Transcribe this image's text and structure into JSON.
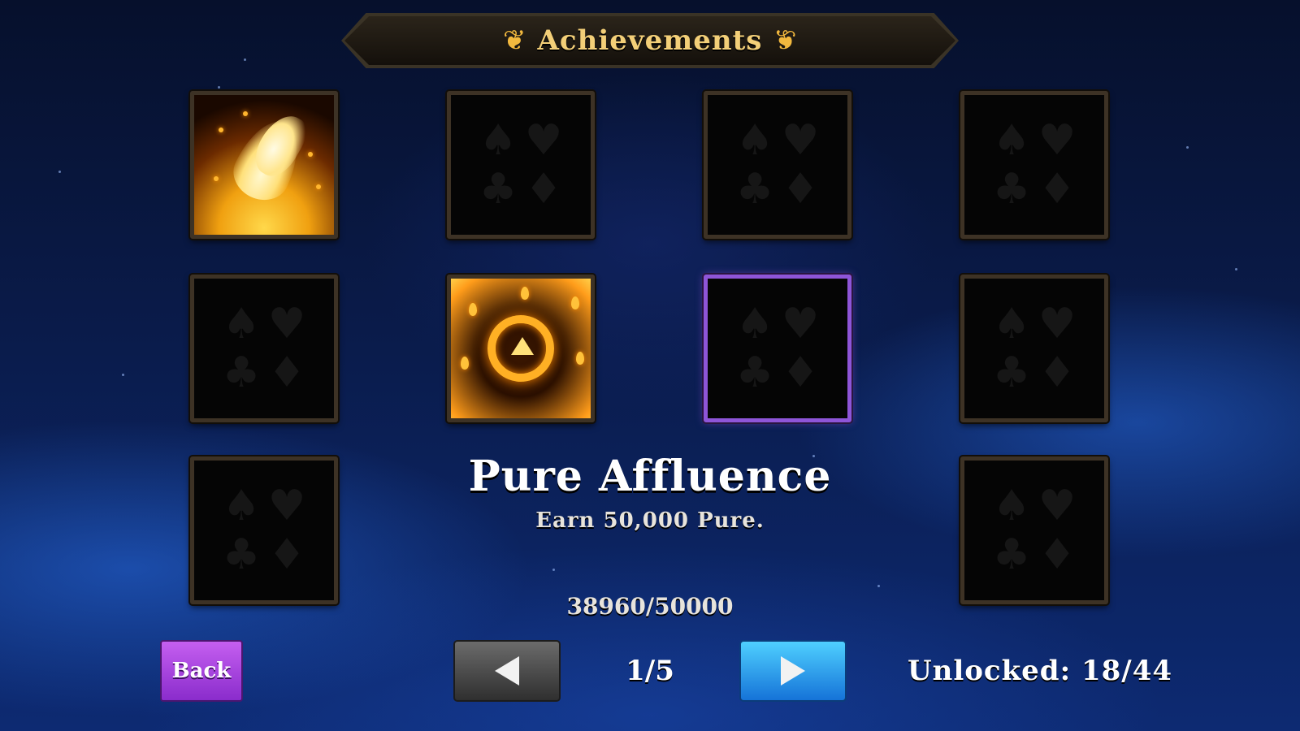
{
  "header": {
    "title": "Achievements",
    "left_flourish_icon": "ornament-flourish-icon",
    "right_flourish_icon": "ornament-flourish-icon"
  },
  "grid": {
    "tiles": [
      {
        "state": "unlocked",
        "icon": "phoenix-flame-icon"
      },
      {
        "state": "locked",
        "icon": "card-suits-icon"
      },
      {
        "state": "locked",
        "icon": "card-suits-icon"
      },
      {
        "state": "locked",
        "icon": "card-suits-icon"
      },
      {
        "state": "locked",
        "icon": "card-suits-icon"
      },
      {
        "state": "unlocked",
        "icon": "fire-ring-icon"
      },
      {
        "state": "locked",
        "icon": "card-suits-icon",
        "selected": true
      },
      {
        "state": "locked",
        "icon": "card-suits-icon"
      },
      {
        "state": "locked",
        "icon": "card-suits-icon"
      },
      {
        "state": "locked",
        "icon": "card-suits-icon"
      }
    ],
    "suits": [
      "♠",
      "♥",
      "♣",
      "♦"
    ]
  },
  "detail": {
    "name": "Pure Affluence",
    "description": "Earn 50,000 Pure.",
    "progress": "38960/50000"
  },
  "footer": {
    "back_label": "Back",
    "page_indicator": "1/5",
    "unlocked_text": "Unlocked: 18/44",
    "prev_icon": "arrow-left-icon",
    "next_icon": "arrow-right-icon"
  },
  "colors": {
    "selected_border": "#8e55d8",
    "back_button": "#b04ee8",
    "next_button": "#2aa0ee",
    "prev_button": "#4a4a4a",
    "title_gold": "#f3cf78"
  }
}
